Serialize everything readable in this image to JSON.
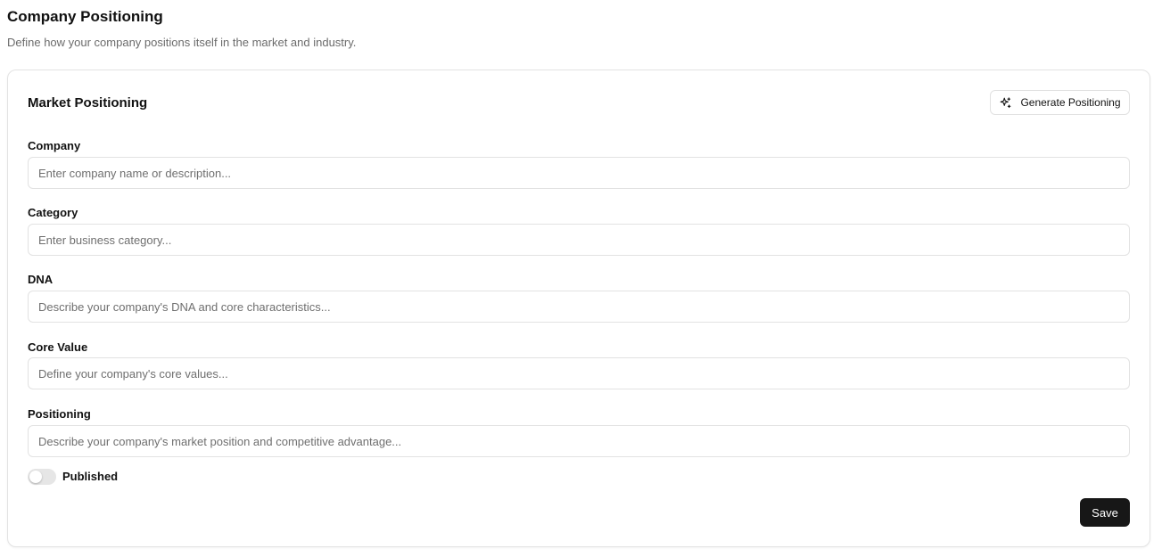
{
  "header": {
    "title": "Company Positioning",
    "subtitle": "Define how your company positions itself in the market and industry."
  },
  "card": {
    "title": "Market Positioning",
    "generate_button": {
      "label": "Generate Positioning",
      "icon": "sparkles-icon"
    }
  },
  "fields": [
    {
      "label": "Company",
      "value": "",
      "placeholder": "Enter company name or description..."
    },
    {
      "label": "Category",
      "value": "",
      "placeholder": "Enter business category..."
    },
    {
      "label": "DNA",
      "value": "",
      "placeholder": "Describe your company's DNA and core characteristics..."
    },
    {
      "label": "Core Value",
      "value": "",
      "placeholder": "Define your company's core values..."
    },
    {
      "label": "Positioning",
      "value": "",
      "placeholder": "Describe your company's market position and competitive advantage..."
    }
  ],
  "published": {
    "label": "Published",
    "checked": false
  },
  "save_label": "Save",
  "colors": {
    "primary_button": "#171717",
    "border": "#e2e2e2",
    "muted_text": "#6b6b6b"
  }
}
